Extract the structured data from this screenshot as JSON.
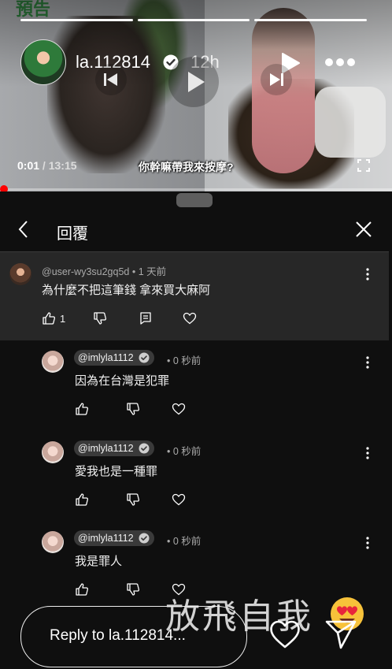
{
  "story": {
    "promo_text": "預告",
    "username": "la.112814",
    "time_ago": "12h",
    "segments": 3
  },
  "video": {
    "current_time": "0:01",
    "duration": "13:15",
    "subtitle": "你幹嘛帶我來按摩?",
    "progress_fraction": 0.003
  },
  "sheet": {
    "title": "回覆"
  },
  "parent_comment": {
    "author": "@user-wy3su2gq5d",
    "age": "1 天前",
    "text": "為什麼不把這筆錢 拿來買大麻阿",
    "likes": "1"
  },
  "replies": [
    {
      "author": "@imlyla1112",
      "age": "0 秒前",
      "text": "因為在台灣是犯罪"
    },
    {
      "author": "@imlyla1112",
      "age": "0 秒前",
      "text": "愛我也是一種罪"
    },
    {
      "author": "@imlyla1112",
      "age": "0 秒前",
      "text": "我是罪人"
    }
  ],
  "reply_bar": {
    "placeholder": "Reply to la.112814..."
  },
  "overlay": {
    "text": "放飛自我",
    "emoji": "heart-eyes-emoji"
  },
  "colors": {
    "background": "#0f0f0f",
    "highlight_row": "#272727",
    "chip": "#3a3a3a",
    "scrub": "#ff0000"
  }
}
